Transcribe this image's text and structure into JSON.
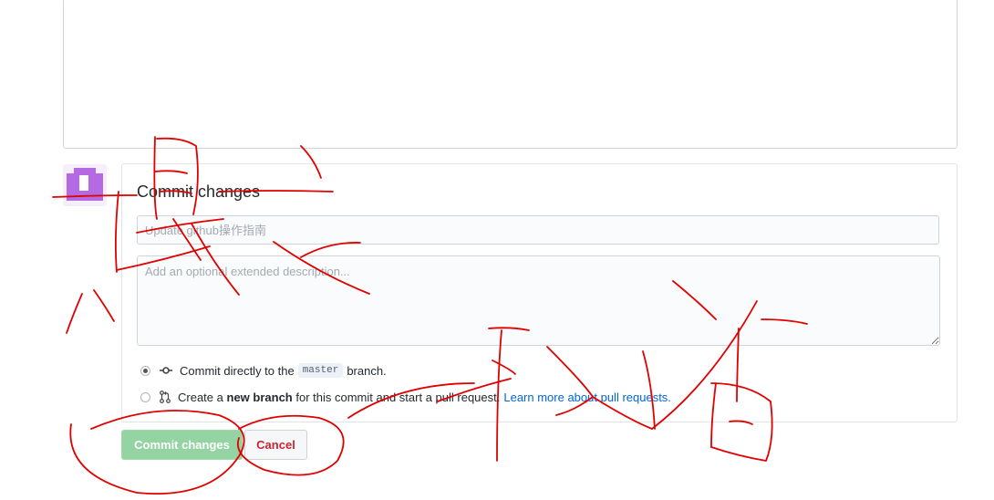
{
  "commit": {
    "title": "Commit changes",
    "summary_placeholder": "Update github操作指南",
    "description_placeholder": "Add an optional extended description...",
    "option_direct": {
      "prefix": "Commit directly to the",
      "branch": "master",
      "suffix": "branch."
    },
    "option_new_branch": {
      "prefix": "Create a",
      "bold": "new branch",
      "suffix": "for this commit and start a pull request.",
      "link": "Learn more about pull requests."
    },
    "buttons": {
      "commit_label": "Commit changes",
      "cancel_label": "Cancel"
    },
    "selected_option": "direct"
  },
  "colors": {
    "avatar_purple": "#b36ae2",
    "commit_button": "#94d3a2",
    "cancel_text": "#cb2431",
    "link": "#0366d6",
    "annotation_red": "#e00000"
  }
}
